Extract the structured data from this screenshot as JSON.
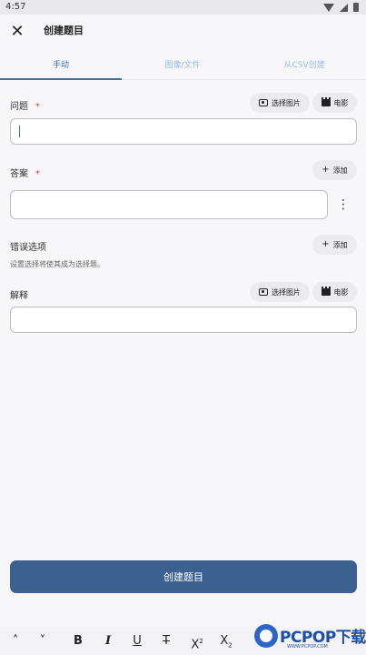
{
  "status_bar": {
    "time": "4:57"
  },
  "app_bar": {
    "title": "创建题目"
  },
  "tabs": [
    {
      "label": "手动",
      "active": true
    },
    {
      "label": "图像/文件",
      "active": false
    },
    {
      "label": "从CSV创建",
      "active": false
    }
  ],
  "form": {
    "question": {
      "label": "问题",
      "required_mark": "*",
      "value": "",
      "image_button": "选择图片",
      "video_button": "电影"
    },
    "answer": {
      "label": "答案",
      "required_mark": "*",
      "value": "",
      "add_button": "添加"
    },
    "wrong_options": {
      "label": "错误选项",
      "hint": "设置选择将使其成为选择题。",
      "add_button": "添加"
    },
    "explanation": {
      "label": "解释",
      "value": "",
      "image_button": "选择图片",
      "video_button": "电影"
    }
  },
  "submit_button": "创建题目",
  "toolbar": {
    "collapse": "˄",
    "expand": "˅",
    "bold": "B",
    "italic": "I",
    "underline": "U",
    "strike": "T",
    "superscript": "X",
    "superscript_mark": "2",
    "subscript": "X",
    "subscript_mark": "2"
  },
  "watermark": {
    "text": "PCPOP下载",
    "sub": "WWW.PCPOP.COM"
  },
  "colors": {
    "accent": "#3a6fa8",
    "submit_bg": "#3b6190",
    "required": "#d94040"
  }
}
